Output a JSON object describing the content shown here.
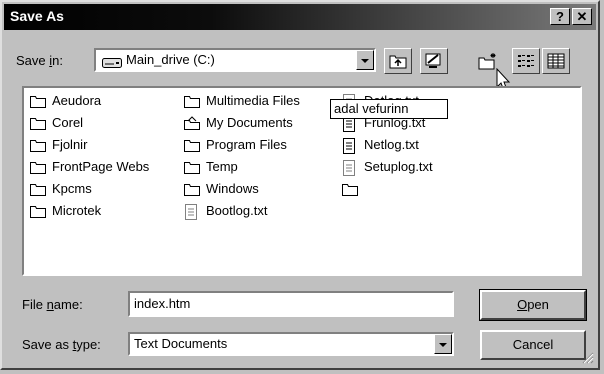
{
  "window": {
    "title": "Save As",
    "help_label": "?",
    "close_label": "✕"
  },
  "save_in": {
    "label_before": "Save ",
    "label_underline": "i",
    "label_after": "n:",
    "value": "Main_drive (C:)"
  },
  "toolbar": {
    "icons": [
      "up-one-level-icon",
      "desktop-icon",
      "new-folder-icon",
      "list-view-icon",
      "details-view-icon"
    ]
  },
  "files": [
    {
      "name": "Aeudora",
      "type": "folder"
    },
    {
      "name": "Corel",
      "type": "folder"
    },
    {
      "name": "Fjolnir",
      "type": "folder"
    },
    {
      "name": "FrontPage Webs",
      "type": "folder"
    },
    {
      "name": "Kpcms",
      "type": "folder"
    },
    {
      "name": "Microtek",
      "type": "folder"
    },
    {
      "name": "Multimedia Files",
      "type": "folder"
    },
    {
      "name": "My Documents",
      "type": "special-folder"
    },
    {
      "name": "Program Files",
      "type": "folder"
    },
    {
      "name": "Temp",
      "type": "folder"
    },
    {
      "name": "Windows",
      "type": "folder"
    },
    {
      "name": "Bootlog.txt",
      "type": "text"
    },
    {
      "name": "Detlog.txt",
      "type": "text"
    },
    {
      "name": "Frunlog.txt",
      "type": "text"
    },
    {
      "name": "Netlog.txt",
      "type": "text"
    },
    {
      "name": "Setuplog.txt",
      "type": "text"
    },
    {
      "name": "adal vefurinn",
      "type": "folder-renaming"
    }
  ],
  "file_name": {
    "label_before": "File ",
    "label_underline": "n",
    "label_after": "ame:",
    "value": "index.htm"
  },
  "save_as_type": {
    "label_before": "Save as ",
    "label_underline": "t",
    "label_after": "ype:",
    "value": "Text Documents"
  },
  "buttons": {
    "open_underline": "O",
    "open_rest": "pen",
    "cancel": "Cancel"
  }
}
